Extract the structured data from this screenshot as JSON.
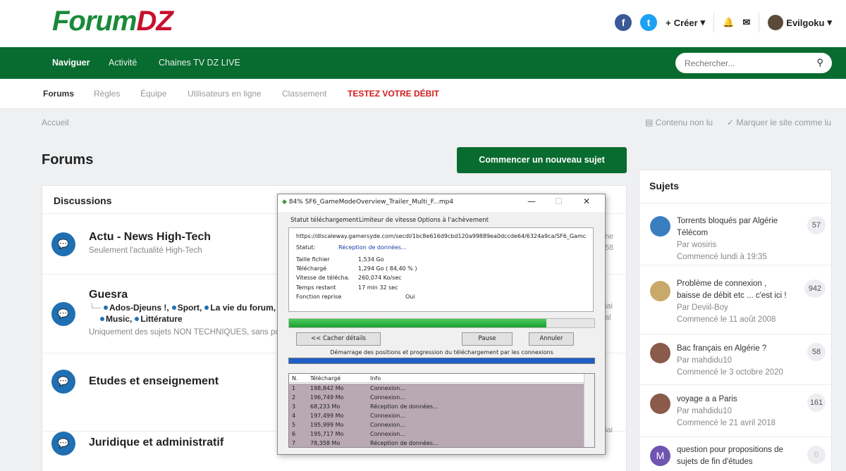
{
  "header": {
    "logo_left": "Forum",
    "logo_right": "DZ",
    "create": "Créer",
    "user": "Evilgoku"
  },
  "nav": {
    "items": [
      "Naviguer",
      "Activité",
      "Chaines TV DZ LIVE"
    ],
    "search_placeholder": "Rechercher..."
  },
  "subnav": {
    "items": [
      "Forums",
      "Règles",
      "Équipe",
      "Utilisateurs en ligne",
      "Classement",
      "TESTEZ VOTRE DÉBIT"
    ]
  },
  "breadcrumb": "Accueil",
  "utils": {
    "unread": "Contenu non lu",
    "mark_read": "Marquer le site comme lu"
  },
  "page": {
    "title": "Forums",
    "new_topic": "Commencer un nouveau sujet"
  },
  "forums": {
    "header": "Discussions",
    "f1": {
      "title": "Actu - News High-Tech",
      "desc": "Seulement l'actualité High-Tech"
    },
    "f2": {
      "title": "Guesra",
      "subs": [
        "Ados-Djeuns !",
        "Sport",
        "La vie du forum",
        "Music",
        "Littérature"
      ],
      "desc": "Uniquement des sujets NON TECHNIQUES, sans po"
    },
    "f3": {
      "title": "Etudes et enseignement"
    },
    "f4": {
      "title": "Juridique et administratif"
    },
    "partial_right": [
      "ne",
      "58",
      "iai",
      "al",
      "iai"
    ]
  },
  "sidebar": {
    "header": "Sujets",
    "topics": [
      {
        "title": "Torrents bloqués par Algérie Télécom",
        "by": "Par wosiris",
        "date": "Commencé lundi à 19:35",
        "count": "57"
      },
      {
        "title": "Problème de connexion , baisse de débit etc ... c'est ici !",
        "by": "Par Deviil-Boy",
        "date": "Commencé le 11 août 2008",
        "count": "942"
      },
      {
        "title": "Bac français en Algérie ?",
        "by": "Par mahdidu10",
        "date": "Commencé le 3 octobre 2020",
        "count": "58"
      },
      {
        "title": "voyage a a Paris",
        "by": "Par mahdidu10",
        "date": "Commencé le 21 avril 2018",
        "count": "161"
      },
      {
        "title": "question pour propositions de sujets de fin d'études",
        "avatar_letter": "M",
        "count": "0"
      }
    ]
  },
  "download": {
    "title": "84% SF6_GameModeOverview_Trailer_Multi_F...mp4",
    "tabs": [
      "Statut téléchargement",
      "Limiteur de vitesse",
      "Options à l'achèvement"
    ],
    "url": "https://dlscaleway.gamersyde.com/secdl/1bc8e616d9cbd120a99889ea0dccde64/6324a9ca/SF6_Gamc",
    "status_label": "Statut:",
    "status": "Réception de données...",
    "fields": [
      {
        "label": "Taille fichier",
        "value": "1,534  Go"
      },
      {
        "label": "Téléchargé",
        "value": "1,294  Go  ( 84,40 % )"
      },
      {
        "label": "Vitesse de télécha.",
        "value": "260,074  Ko/sec"
      },
      {
        "label": "Temps restant",
        "value": "17 min 32 sec"
      },
      {
        "label": "Fonction reprise",
        "value": "Oui"
      }
    ],
    "progress": 0.844,
    "buttons": {
      "details": "<< Cacher détails",
      "pause": "Pause",
      "cancel": "Annuler"
    },
    "segments_title": "Démarrage des positions et progression du téléchargement par les connexions",
    "columns": [
      "N.",
      "Téléchargé",
      "Info"
    ],
    "rows": [
      [
        "1",
        "198,842  Mo",
        "Connexion..."
      ],
      [
        "2",
        "196,749  Mo",
        "Connexion..."
      ],
      [
        "3",
        "68,233  Mo",
        "Réception de données..."
      ],
      [
        "4",
        "197,499  Mo",
        "Connexion..."
      ],
      [
        "5",
        "195,999  Mo",
        "Connexion..."
      ],
      [
        "6",
        "195,717  Mo",
        "Connexion..."
      ],
      [
        "7",
        "78,358  Mo",
        "Réception de données..."
      ]
    ]
  }
}
